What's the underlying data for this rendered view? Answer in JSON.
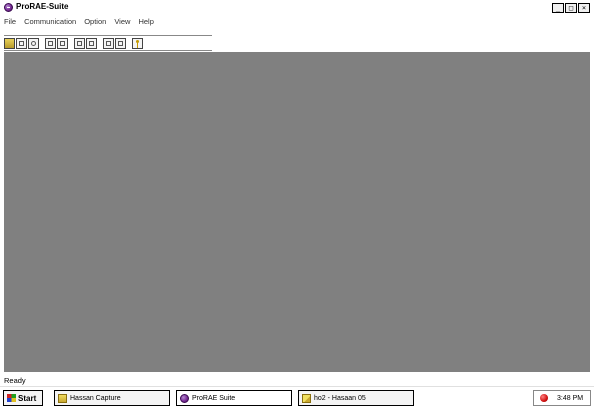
{
  "window": {
    "title": "ProRAE-Suite",
    "controls": {
      "minimize": "_",
      "maximize": "□",
      "close": "×"
    }
  },
  "menu": [
    {
      "label": "File"
    },
    {
      "label": "Communication"
    },
    {
      "label": "Option"
    },
    {
      "label": "View"
    },
    {
      "label": "Help"
    }
  ],
  "toolbar": {
    "groups": [
      [
        "open-icon",
        "monitor-icon",
        "settings-icon"
      ],
      [
        "receive-icon",
        "send-icon"
      ],
      [
        "compress-icon",
        "expand-icon"
      ],
      [
        "upload-icon",
        "download-icon"
      ],
      [
        "key-icon"
      ]
    ]
  },
  "status": {
    "text": "Ready"
  },
  "taskbar": {
    "start": "Start",
    "tasks": [
      {
        "label": "Hassan Capture",
        "icon": "folder-icon"
      },
      {
        "label": "ProRAE Suite",
        "icon": "app-icon"
      },
      {
        "label": "ho2 - Hasaan 05",
        "icon": "document-icon"
      }
    ],
    "clock": "3:48 PM"
  },
  "colors": {
    "client_background": "#808080",
    "app_icon": "#7a2f98",
    "tray_alert": "#d01010"
  }
}
